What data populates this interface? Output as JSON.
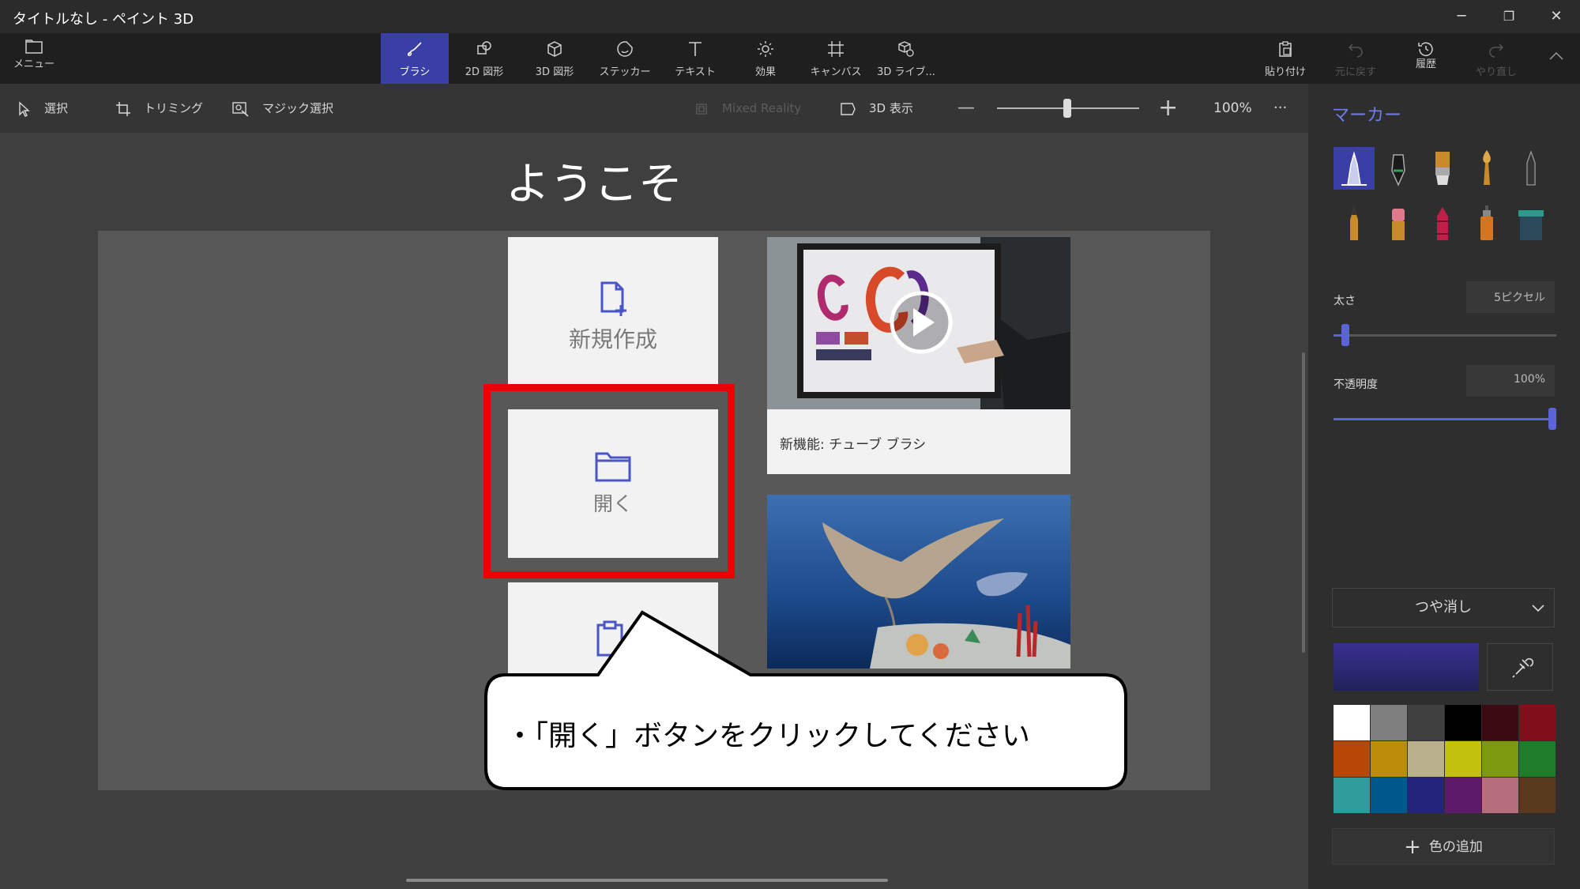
{
  "window": {
    "title": "タイトルなし - ペイント 3D",
    "minimize": "─",
    "restore": "❐",
    "close": "✕"
  },
  "toolbar": {
    "menu": "メニュー",
    "items": [
      {
        "label": "ブラシ",
        "icon": "brush-icon",
        "active": true
      },
      {
        "label": "2D 図形",
        "icon": "2d-shapes-icon"
      },
      {
        "label": "3D 図形",
        "icon": "3d-shapes-icon"
      },
      {
        "label": "ステッカー",
        "icon": "sticker-icon"
      },
      {
        "label": "テキスト",
        "icon": "text-icon"
      },
      {
        "label": "効果",
        "icon": "effects-icon"
      },
      {
        "label": "キャンバス",
        "icon": "canvas-icon"
      },
      {
        "label": "3D ライブ...",
        "icon": "3d-library-icon"
      }
    ],
    "paste": "貼り付け",
    "undo": "元に戻す",
    "history": "履歴",
    "redo": "やり直し"
  },
  "subbar": {
    "select": "選択",
    "crop": "トリミング",
    "magic_select": "マジック選択",
    "mixed_reality": "Mixed Reality",
    "view_3d": "3D 表示",
    "zoom_out": "—",
    "zoom_in": "+",
    "zoom": "100%",
    "more": "···"
  },
  "welcome": {
    "title": "ようこそ",
    "new": "新規作成",
    "open": "開く",
    "video1_caption": "新機能: チューブ ブラシ"
  },
  "callout": {
    "text": "・「開く」ボタンをクリックしてください"
  },
  "panel": {
    "title": "マーカー",
    "thickness_label": "太さ",
    "thickness_value": "5ピクセル",
    "thickness_level": 0.05,
    "opacity_label": "不透明度",
    "opacity_value": "100%",
    "opacity_level": 1.0,
    "finish": "つや消し",
    "add_color": "色の追加",
    "add_color_icon": "+",
    "palette": [
      "#ffffff",
      "#7f7f7f",
      "#404040",
      "#000000",
      "#3b0a12",
      "#7f0f19",
      "#b64706",
      "#bb8d0a",
      "#b9b08c",
      "#c2c20e",
      "#7d9a0e",
      "#1e7d2a",
      "#2f9b9b",
      "#00578a",
      "#23237b",
      "#5d1a6b",
      "#b66e7c",
      "#5a3a1e"
    ]
  }
}
